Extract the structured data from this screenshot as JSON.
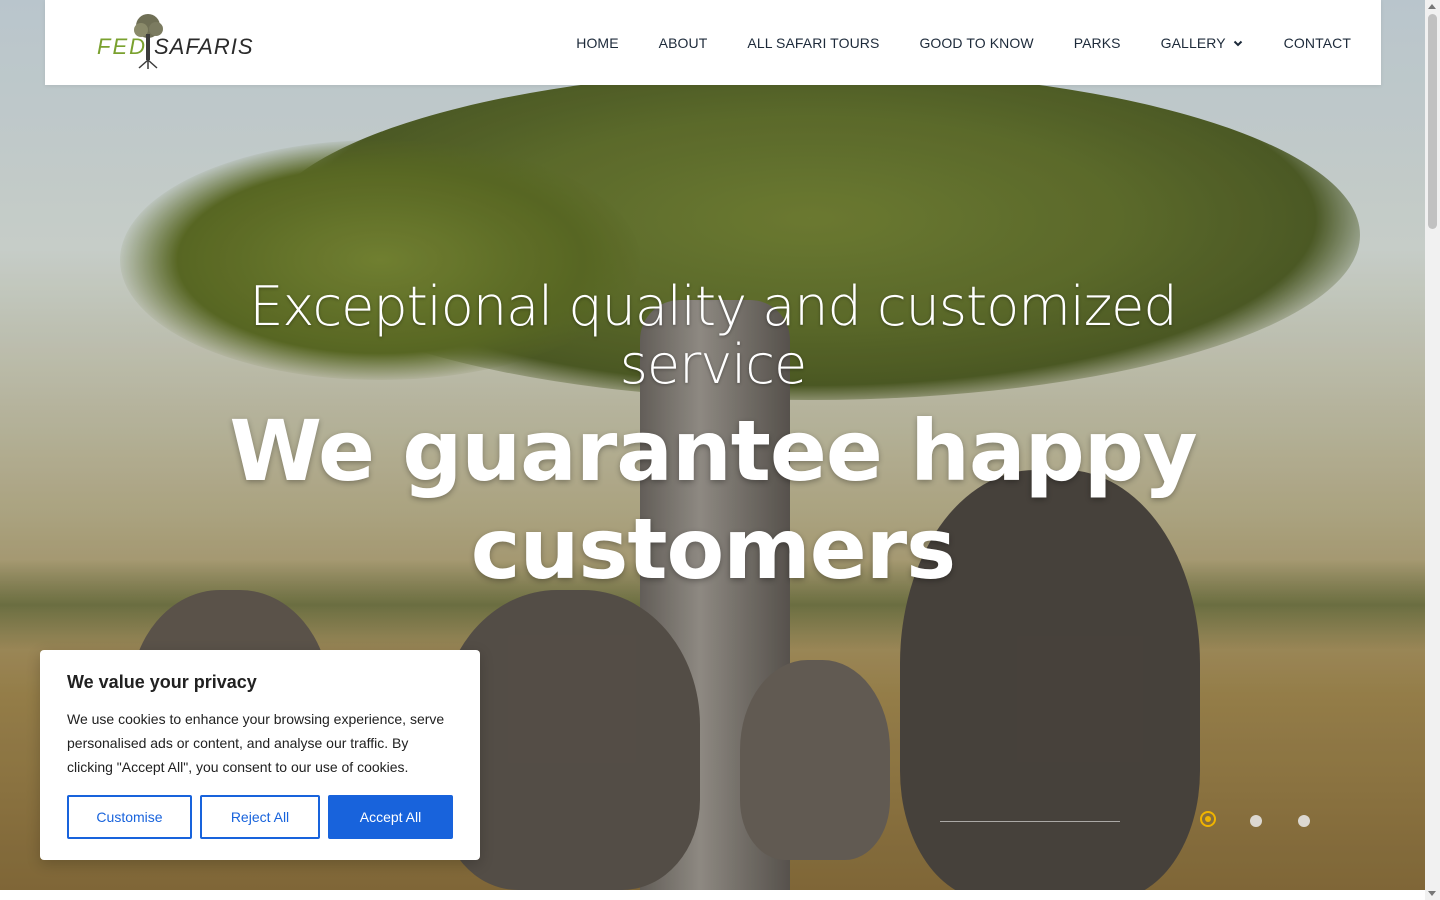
{
  "header": {
    "logo": {
      "part1": "FED",
      "part2": "SAFARIS"
    },
    "nav": [
      {
        "label": "HOME"
      },
      {
        "label": "ABOUT"
      },
      {
        "label": "ALL SAFARI TOURS"
      },
      {
        "label": "GOOD TO KNOW"
      },
      {
        "label": "PARKS"
      },
      {
        "label": "GALLERY",
        "icon": "chevron-down-icon"
      },
      {
        "label": "CONTACT"
      }
    ]
  },
  "hero": {
    "subtitle": "Exceptional quality and customized service",
    "title": "We guarantee happy customers",
    "slider": {
      "total": 3,
      "active": 1,
      "accent_color": "#f0b400"
    }
  },
  "cookie_banner": {
    "title": "We value your privacy",
    "body": "We use cookies to enhance your browsing experience, serve personalised ads or content, and analyse our traffic. By clicking \"Accept All\", you consent to our use of cookies.",
    "customise_label": "Customise",
    "reject_label": "Reject All",
    "accept_label": "Accept All",
    "accent_color": "#1863dc"
  }
}
